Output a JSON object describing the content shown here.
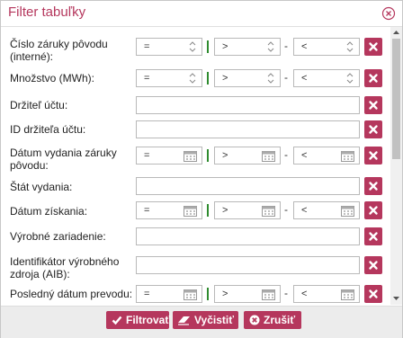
{
  "dialog": {
    "title": "Filter tabuľky",
    "close_icon": "close-circle-icon"
  },
  "placeholders": {
    "eq": "=",
    "gt": ">",
    "lt": "<",
    "dash": "-"
  },
  "rows": [
    {
      "label": "Číslo záruky pôvodu (interné):",
      "type": "number-range"
    },
    {
      "label": "Množstvo (MWh):",
      "type": "number-range"
    },
    {
      "label": "Držiteľ účtu:",
      "type": "text"
    },
    {
      "label": "ID držiteľa účtu:",
      "type": "text"
    },
    {
      "label": "Dátum vydania záruky pôvodu:",
      "type": "date-range"
    },
    {
      "label": "Štát vydania:",
      "type": "text"
    },
    {
      "label": "Dátum získania:",
      "type": "date-range"
    },
    {
      "label": "Výrobné zariadenie:",
      "type": "text"
    },
    {
      "label": "Identifikátor výrobného zdroja (AIB):",
      "type": "text"
    },
    {
      "label": "Posledný dátum prevodu:",
      "type": "date-range"
    }
  ],
  "footer": {
    "filter_label": "Filtrovať",
    "clear_label": "Vyčistiť",
    "cancel_label": "Zrušiť"
  },
  "colors": {
    "accent": "#b5375d",
    "separator": "#2e8b2e"
  }
}
